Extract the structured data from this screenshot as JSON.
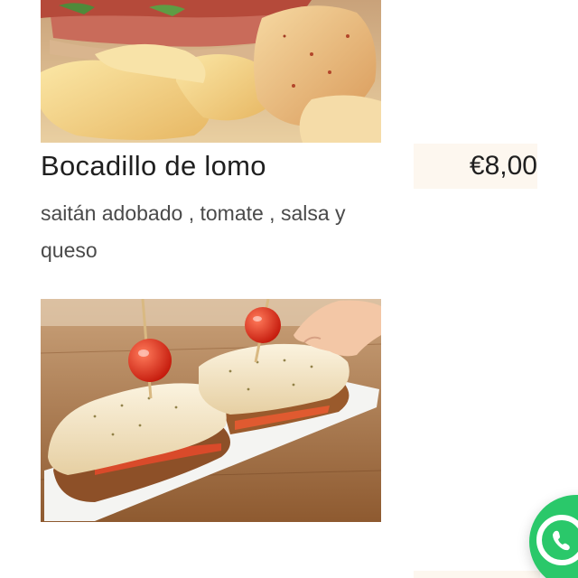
{
  "menu_item": {
    "title": "Bocadillo de lomo",
    "price": "€8,00",
    "description": "saitán adobado , tomate , salsa y queso"
  },
  "images": {
    "top_photo": "fries-and-sandwich-photo",
    "sandwich_photo": "bocadillo-de-lomo-photo"
  },
  "whatsapp": {
    "icon": "whatsapp-icon",
    "color": "#2ac86a"
  },
  "colors": {
    "price_background": "#fdf7ef",
    "title_text": "#1f1f1f",
    "description_text": "#4a4a4a"
  }
}
